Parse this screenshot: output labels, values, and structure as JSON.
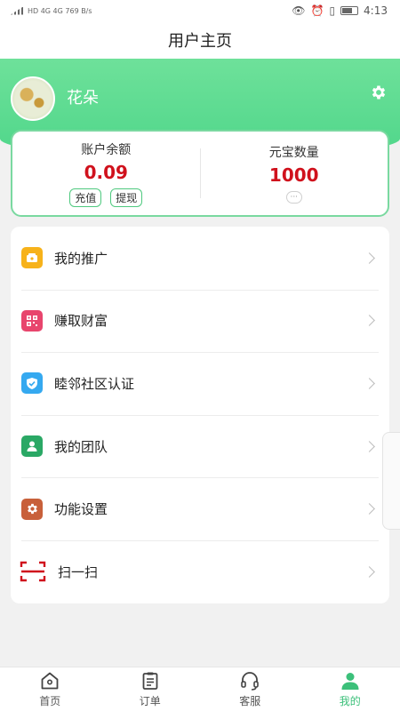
{
  "status_bar": {
    "left_text": "HD 4G 4G 769 B/s",
    "time": "4:13"
  },
  "header": {
    "title": "用户主页"
  },
  "profile": {
    "username": "花朵",
    "settings_icon": "gear-icon"
  },
  "balance": {
    "label": "账户余额",
    "value": "0.09",
    "recharge_label": "充值",
    "withdraw_label": "提现"
  },
  "ingots": {
    "label": "元宝数量",
    "value": "1000",
    "more_label": "···"
  },
  "menu": {
    "items": [
      {
        "label": "我的推广",
        "icon": "wallet-icon",
        "color": "#f7b21a"
      },
      {
        "label": "赚取财富",
        "icon": "qr-code-icon",
        "color": "#e8456d"
      },
      {
        "label": "睦邻社区认证",
        "icon": "shield-check-icon",
        "color": "#35a9f0"
      },
      {
        "label": "我的团队",
        "icon": "user-badge-icon",
        "color": "#2aa865"
      },
      {
        "label": "功能设置",
        "icon": "gear-icon",
        "color": "#c8603a"
      },
      {
        "label": "扫一扫",
        "icon": "scan-icon",
        "color": "#d0111c"
      }
    ]
  },
  "tabbar": {
    "items": [
      {
        "label": "首页",
        "icon": "home-icon"
      },
      {
        "label": "订单",
        "icon": "clipboard-icon"
      },
      {
        "label": "客服",
        "icon": "headset-icon"
      },
      {
        "label": "我的",
        "icon": "user-icon",
        "active": true
      }
    ],
    "active_color": "#3cc07a"
  },
  "colors": {
    "brand_green": "#4fd68a",
    "value_red": "#d0111c"
  }
}
